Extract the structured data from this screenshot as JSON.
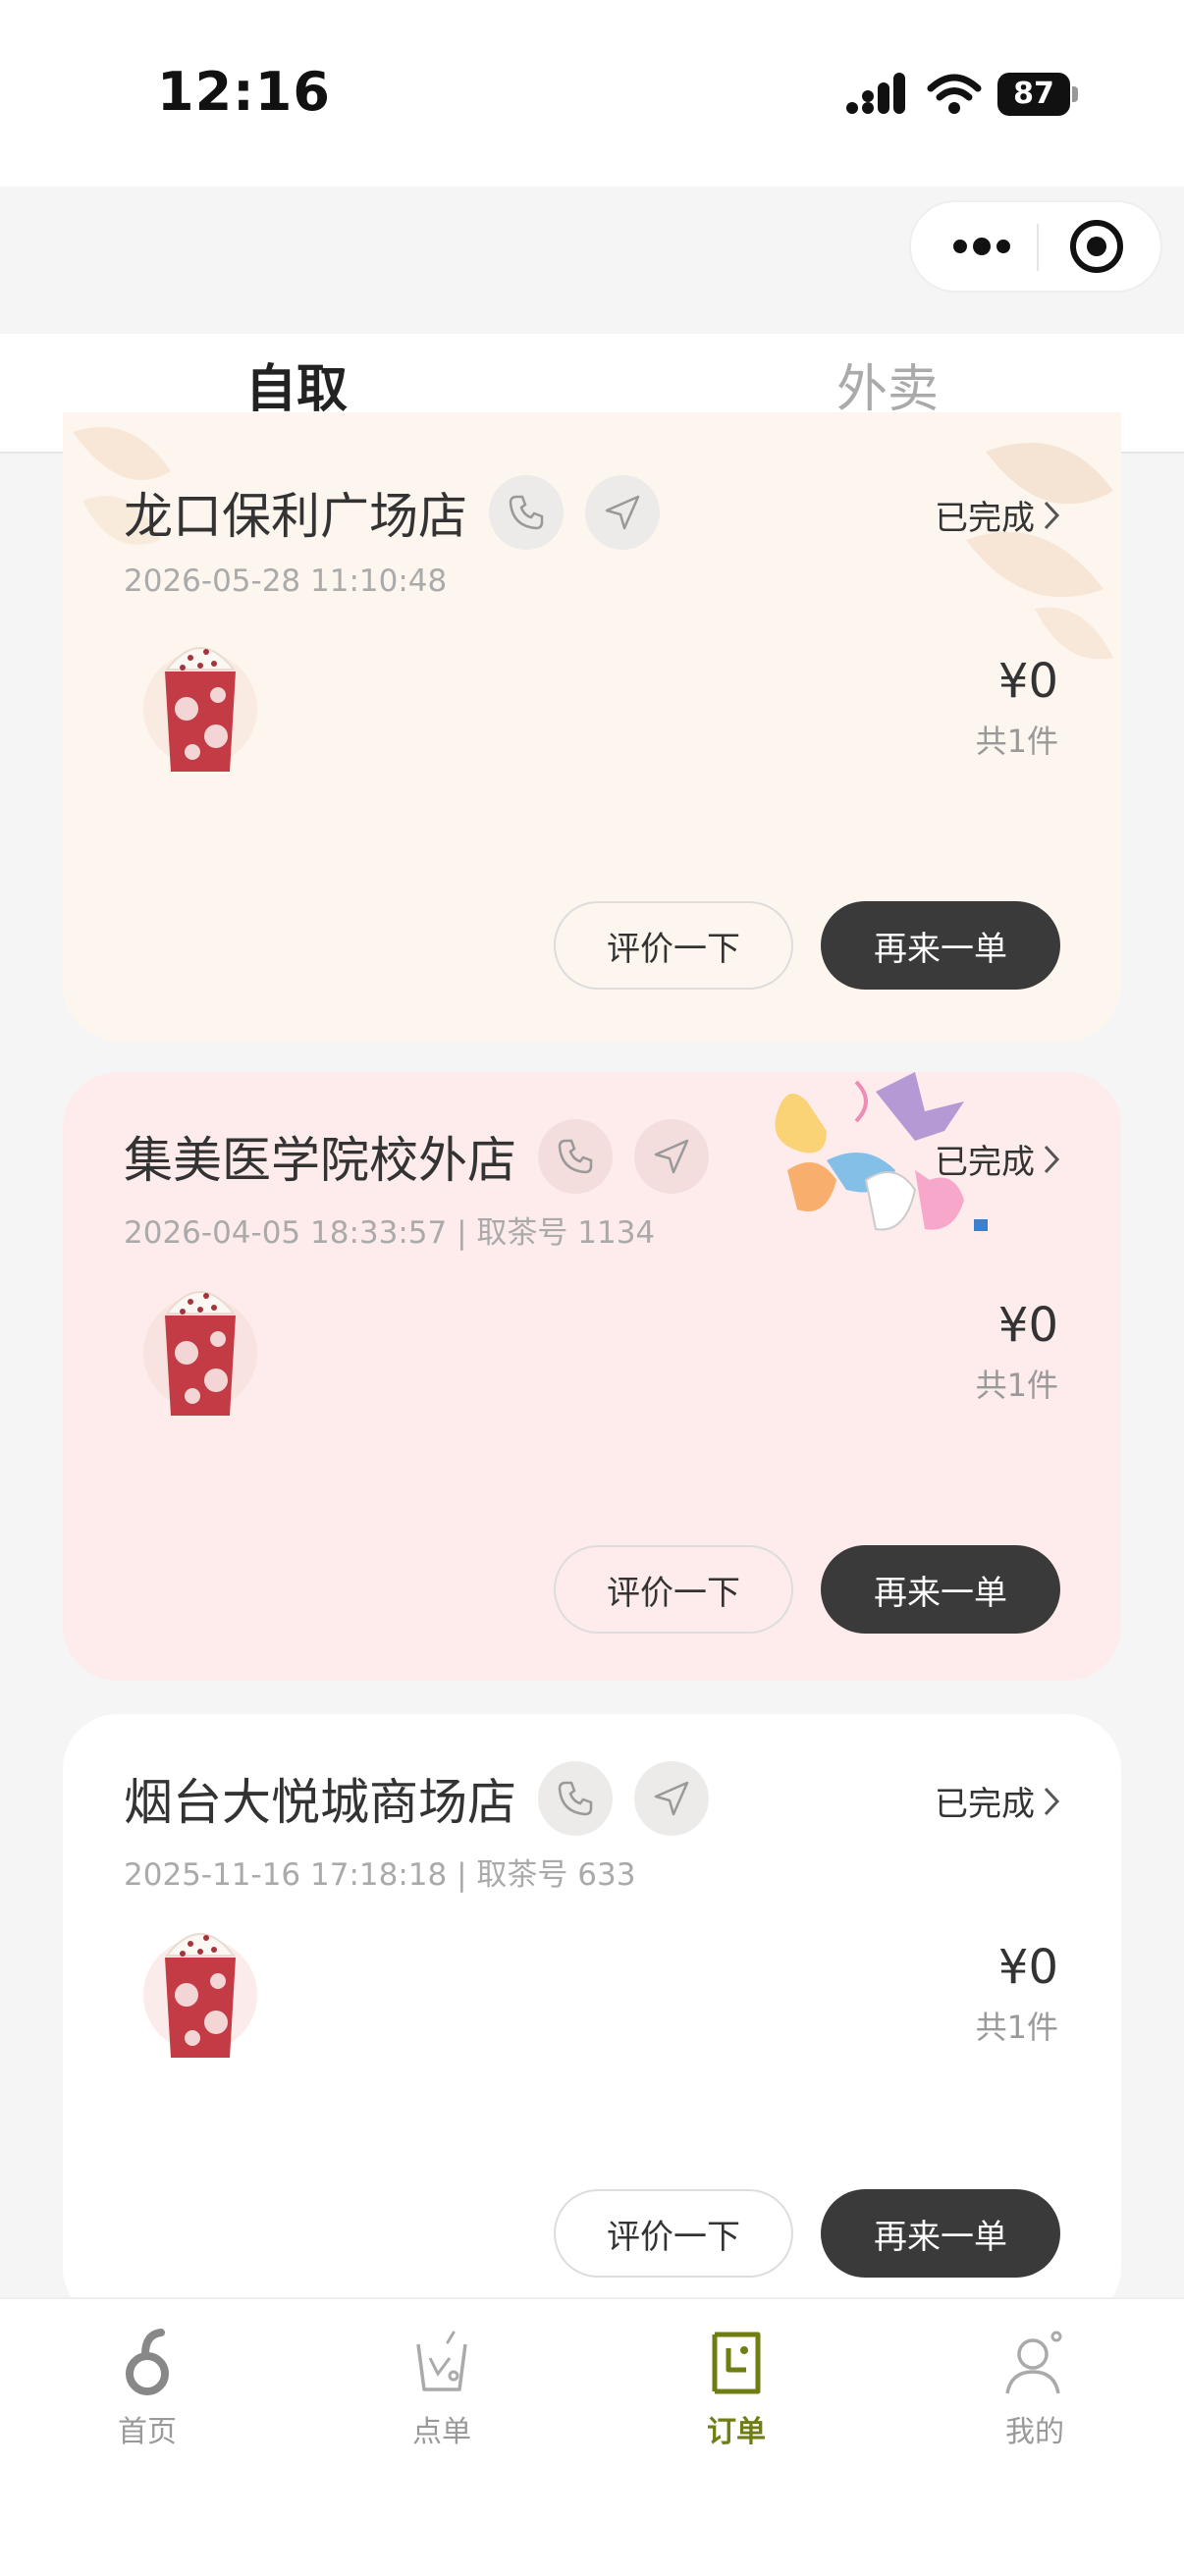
{
  "status_bar": {
    "time": "12:16",
    "battery": "87"
  },
  "tabs": [
    {
      "label": "自取",
      "active": true
    },
    {
      "label": "外卖",
      "active": false
    }
  ],
  "orders": [
    {
      "store": "龙口保利广场店",
      "meta": "2026-05-28 11:10:48",
      "status": "已完成",
      "price": "¥0",
      "count": "共1件",
      "review_label": "评价一下",
      "reorder_label": "再来一单"
    },
    {
      "store": "集美医学院校外店",
      "meta": "2026-04-05 18:33:57 | 取茶号 1134",
      "status": "已完成",
      "price": "¥0",
      "count": "共1件",
      "review_label": "评价一下",
      "reorder_label": "再来一单"
    },
    {
      "store": "烟台大悦城商场店",
      "meta": "2025-11-16 17:18:18 | 取茶号 633",
      "status": "已完成",
      "price": "¥0",
      "count": "共1件",
      "review_label": "评价一下",
      "reorder_label": "再来一单"
    }
  ],
  "bottom_nav": [
    {
      "label": "首页",
      "icon": "home-icon",
      "active": false
    },
    {
      "label": "点单",
      "icon": "order-cup-icon",
      "active": false
    },
    {
      "label": "订单",
      "icon": "orders-icon",
      "active": true
    },
    {
      "label": "我的",
      "icon": "profile-icon",
      "active": false
    }
  ],
  "colors": {
    "accent": "#6f7d12",
    "button_dark": "#3a3a3a",
    "card1_bg": "#fdf6ee",
    "card2_bg": "#fdeceb",
    "card3_bg": "#ffffff"
  }
}
